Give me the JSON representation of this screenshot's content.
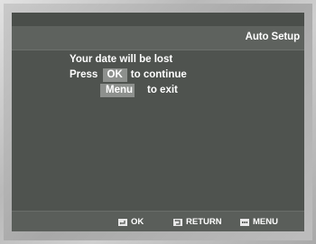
{
  "screen": {
    "title": "Auto Setup"
  },
  "message": {
    "line1": "Your date will be lost",
    "press_prefix": "Press",
    "ok_button": "OK",
    "continue_text": "to continue",
    "menu_button": "Menu",
    "exit_text": "to exit"
  },
  "footer": {
    "items": [
      {
        "label": "OK",
        "icon": "enter-icon"
      },
      {
        "label": "RETURN",
        "icon": "return-icon"
      },
      {
        "label": "MENU",
        "icon": "menu-icon"
      }
    ]
  },
  "colors": {
    "screen_bg": "#4e524e",
    "button_bg": "#8d908d",
    "text": "#ffffff"
  }
}
